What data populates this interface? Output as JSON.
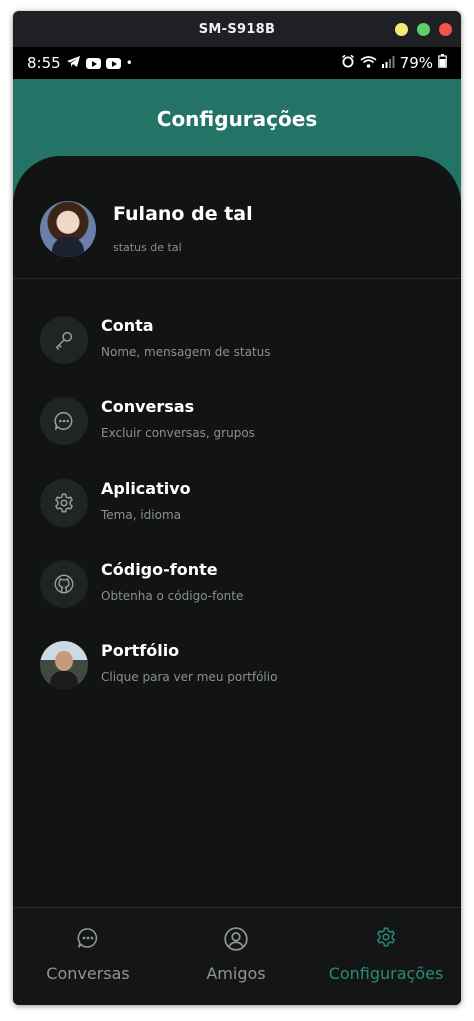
{
  "window": {
    "title": "SM-S918B"
  },
  "statusbar": {
    "time": "8:55",
    "dot": "•",
    "battery": "79%"
  },
  "header": {
    "title": "Configurações"
  },
  "profile": {
    "name": "Fulano de tal",
    "status": "status de tal"
  },
  "settings": [
    {
      "title": "Conta",
      "subtitle": "Nome, mensagem de status",
      "icon": "key-icon"
    },
    {
      "title": "Conversas",
      "subtitle": "Excluir conversas, grupos",
      "icon": "chat-bubble-icon"
    },
    {
      "title": "Aplicativo",
      "subtitle": "Tema, idioma",
      "icon": "gear-icon"
    },
    {
      "title": "Código-fonte",
      "subtitle": "Obtenha o código-fonte",
      "icon": "github-icon"
    },
    {
      "title": "Portfólio",
      "subtitle": "Clique para ver meu portfólio",
      "icon": "portfolio-photo"
    }
  ],
  "nav": {
    "items": [
      {
        "label": "Conversas",
        "icon": "chat-bubble-icon",
        "active": false
      },
      {
        "label": "Amigos",
        "icon": "user-circle-icon",
        "active": false
      },
      {
        "label": "Configurações",
        "icon": "gear-icon",
        "active": true
      }
    ]
  },
  "colors": {
    "accent": "#237467",
    "background": "#121414",
    "nav_inactive": "#8f9494",
    "nav_active": "#2a8a79"
  }
}
